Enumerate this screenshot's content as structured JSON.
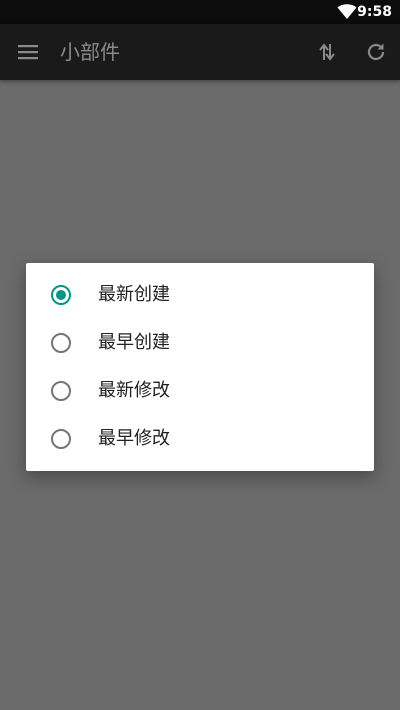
{
  "status_bar": {
    "time": "9:58",
    "wifi_icon": "wifi-icon"
  },
  "app_bar": {
    "title": "小部件",
    "menu_icon": "menu-icon",
    "sort_icon": "sort-icon",
    "refresh_icon": "refresh-icon"
  },
  "sort_dialog": {
    "options": [
      {
        "label": "最新创建",
        "selected": true
      },
      {
        "label": "最早创建",
        "selected": false
      },
      {
        "label": "最新修改",
        "selected": false
      },
      {
        "label": "最早修改",
        "selected": false
      }
    ]
  },
  "colors": {
    "accent": "#009688",
    "scrim": "#6b6b6b",
    "app_bar": "#1a1a1a",
    "status_bar": "#0c0c0c"
  }
}
